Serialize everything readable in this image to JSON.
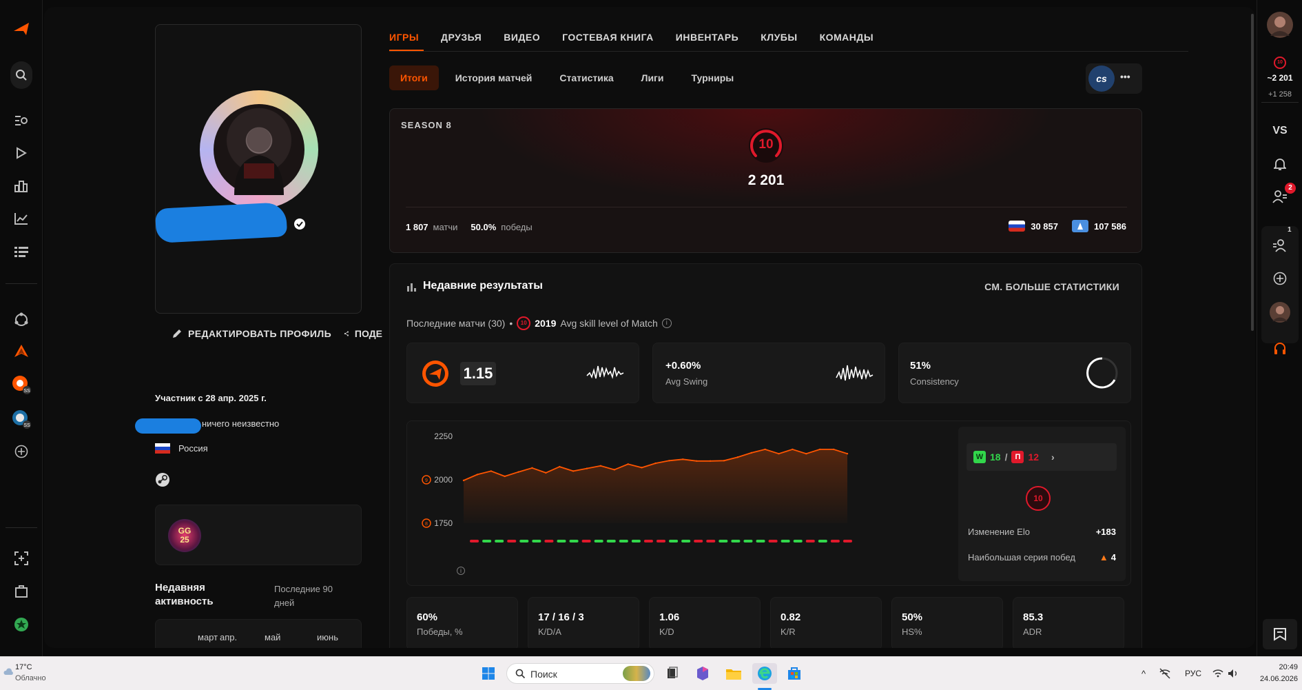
{
  "left_rail": {
    "items": [
      {
        "name": "logo-icon",
        "glyph": "◢"
      },
      {
        "name": "search-icon",
        "glyph": "⌕"
      },
      {
        "name": "find-players-icon",
        "glyph": "⌸"
      },
      {
        "name": "watch-icon",
        "glyph": "▷"
      },
      {
        "name": "ranking-icon",
        "glyph": "▥"
      },
      {
        "name": "stats-icon",
        "glyph": "⟋"
      },
      {
        "name": "tasks-icon",
        "glyph": "☰"
      },
      {
        "name": "clubs-icon",
        "glyph": "◌"
      },
      {
        "name": "hub-icon",
        "glyph": "▲"
      },
      {
        "name": "hub2-icon",
        "glyph": "●"
      },
      {
        "name": "hub3-icon",
        "glyph": "●"
      },
      {
        "name": "add-icon",
        "glyph": "⊕"
      },
      {
        "name": "screenshot-icon",
        "glyph": "⬚"
      },
      {
        "name": "briefcase-icon",
        "glyph": "▣"
      },
      {
        "name": "premium-icon",
        "glyph": "✪"
      }
    ]
  },
  "profile": {
    "level": "10",
    "edit_label": "РЕДАКТИРОВАТЬ ПРОФИЛЬ",
    "share_label": "ПОДЕ",
    "member_since": "Участник с 28 апр. 2025 г.",
    "about": "ничего неизвестно",
    "country": "Россия",
    "badge_text": "GG\n25",
    "activity_title": "Недавняя активность",
    "activity_period": "Последние 90 дней",
    "activity_months": [
      "март",
      "апр.",
      "май",
      "июнь"
    ]
  },
  "tabs": {
    "items": [
      "ИГРЫ",
      "ДРУЗЬЯ",
      "ВИДЕО",
      "ГОСТЕВАЯ КНИГА",
      "ИНВЕНТАРЬ",
      "КЛУБЫ",
      "КОМАНДЫ"
    ],
    "active": 0
  },
  "subtabs": {
    "items": [
      "Итоги",
      "История матчей",
      "Статистика",
      "Лиги",
      "Турниры"
    ],
    "active": 0,
    "game_badge": "cs",
    "more": "•••"
  },
  "season": {
    "label": "SEASON 8",
    "level": "10",
    "elo": "2 201",
    "matches_value": "1 807",
    "matches_label": "матчи",
    "wins_value": "50.0%",
    "wins_label": "победы",
    "country_rank": "30 857",
    "region_rank": "107 586"
  },
  "recent": {
    "title": "Недавние результаты",
    "more_stats": "СМ. БОЛЬШЕ СТАТИСТИКИ",
    "last_matches": "Последние матчи (30)",
    "dot": "•",
    "avg_level": "10",
    "avg_skill_value": "2019",
    "avg_skill_label": "Avg skill level of Match",
    "rating": "1.15",
    "swing_value": "+0.60%",
    "swing_label": "Avg Swing",
    "consistency_value": "51%",
    "consistency_label": "Consistency"
  },
  "chart_data": {
    "type": "line",
    "y_ticks": [
      "2250",
      "2000",
      "1750"
    ],
    "tick_levels": [
      "9",
      "8"
    ],
    "ylim": [
      1750,
      2250
    ],
    "values": [
      1996,
      2030,
      2050,
      2020,
      2045,
      2068,
      2040,
      2075,
      2050,
      2065,
      2080,
      2058,
      2090,
      2070,
      2095,
      2110,
      2118,
      2108,
      2108,
      2110,
      2130,
      2155,
      2175,
      2150,
      2175,
      2150,
      2175,
      2175,
      2150
    ],
    "results": [
      "L",
      "W",
      "W",
      "L",
      "W",
      "W",
      "L",
      "W",
      "W",
      "L",
      "W",
      "W",
      "W",
      "W",
      "L",
      "L",
      "W",
      "W",
      "L",
      "L",
      "W",
      "W",
      "W",
      "W",
      "L",
      "W",
      "W",
      "L",
      "W",
      "L",
      "L"
    ],
    "line_color": "#ff5500",
    "win_color": "#32d74b",
    "loss_color": "#e0192b"
  },
  "elo_box": {
    "w_badge": "W",
    "wins": "18",
    "sep": "/",
    "l_badge": "П",
    "losses": "12",
    "level": "10",
    "elo_change_label": "Изменение Elo",
    "elo_change_value": "+183",
    "streak_label": "Наибольшая серия побед",
    "streak_value": "4"
  },
  "stats": [
    {
      "value": "60%",
      "label": "Победы, %"
    },
    {
      "value": "17 / 16 / 3",
      "label": "K/D/A"
    },
    {
      "value": "1.06",
      "label": "K/D"
    },
    {
      "value": "0.82",
      "label": "K/R"
    },
    {
      "value": "50%",
      "label": "HS%"
    },
    {
      "value": "85.3",
      "label": "ADR"
    }
  ],
  "right_rail": {
    "level": "10",
    "elo": "~2 201",
    "elo_delta": "+1 258",
    "vs": "VS",
    "friends_badge": "2",
    "party_badge": "1"
  },
  "taskbar": {
    "weather_temp": "17°C",
    "weather_text": "Облачно",
    "search_placeholder": "Поиск",
    "lang": "РУС",
    "time": "20:49",
    "date": "24.06.2026"
  },
  "colors": {
    "accent": "#ff5500",
    "level_red": "#e0192b"
  }
}
